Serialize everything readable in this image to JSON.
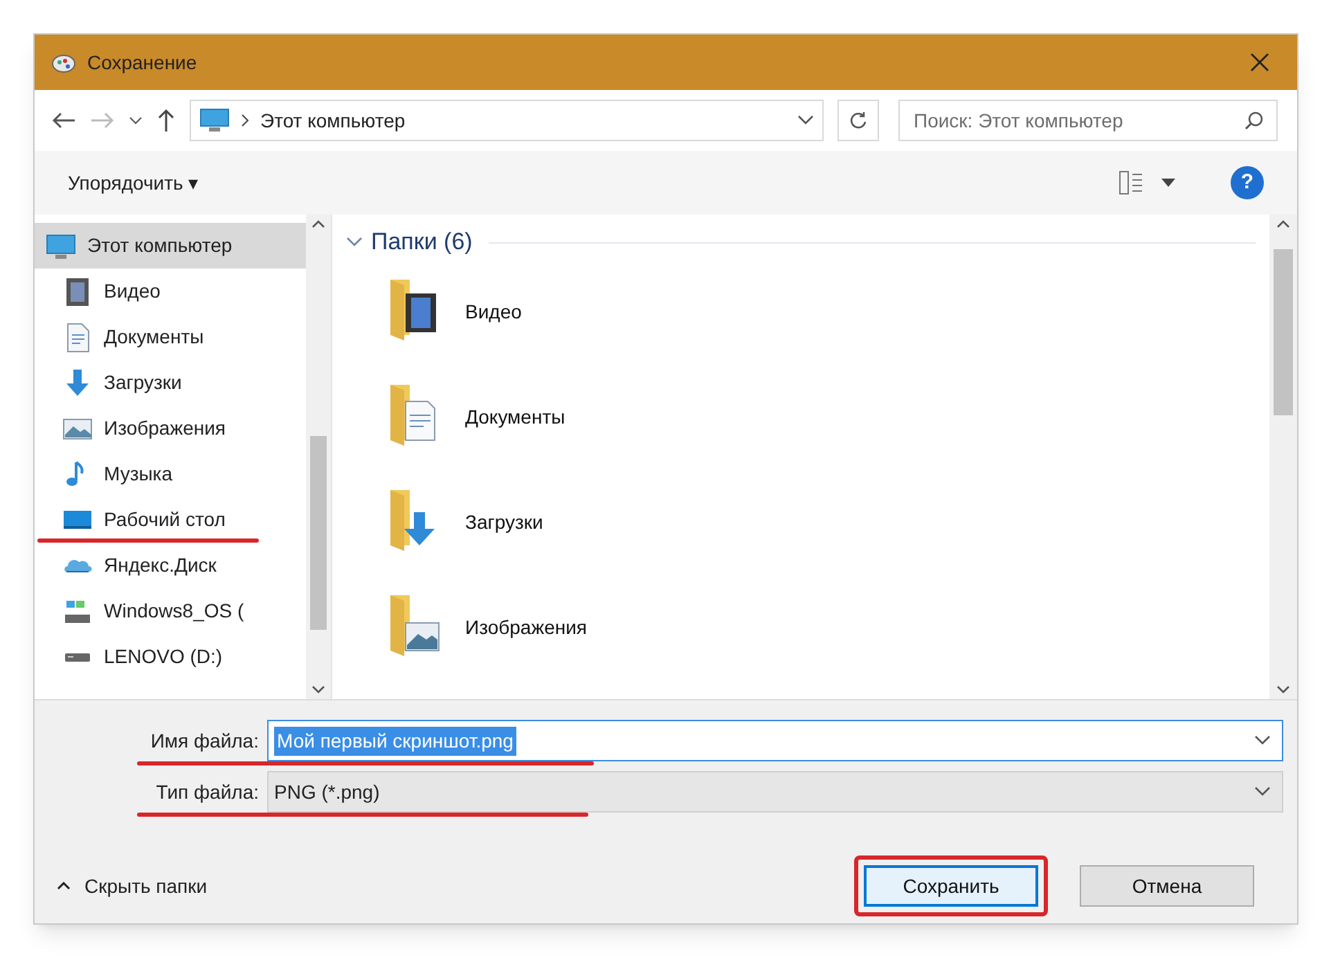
{
  "window": {
    "title": "Сохранение"
  },
  "address_bar": {
    "path": "Этот компьютер"
  },
  "search": {
    "placeholder": "Поиск: Этот компьютер"
  },
  "toolbar": {
    "organize": "Упорядочить ▾",
    "help": "?"
  },
  "sidebar": {
    "items": [
      {
        "label": "Этот компьютер",
        "kind": "pc",
        "selected": true,
        "highlighted": false,
        "children": [
          {
            "label": "Видео",
            "kind": "video",
            "selected": false,
            "highlighted": false
          },
          {
            "label": "Документы",
            "kind": "docs",
            "selected": false,
            "highlighted": false
          },
          {
            "label": "Загрузки",
            "kind": "downloads",
            "selected": false,
            "highlighted": false
          },
          {
            "label": "Изображения",
            "kind": "pictures",
            "selected": false,
            "highlighted": false
          },
          {
            "label": "Музыка",
            "kind": "music",
            "selected": false,
            "highlighted": false
          },
          {
            "label": "Рабочий стол",
            "kind": "desktop",
            "selected": false,
            "highlighted": true
          },
          {
            "label": "Яндекс.Диск",
            "kind": "cloud",
            "selected": false,
            "highlighted": false
          },
          {
            "label": "Windows8_OS (",
            "kind": "osdrive",
            "selected": false,
            "highlighted": false
          },
          {
            "label": "LENOVO (D:)",
            "kind": "drive",
            "selected": false,
            "highlighted": false
          }
        ]
      }
    ]
  },
  "content": {
    "group": "Папки (6)",
    "folders": [
      {
        "label": "Видео",
        "kind": "video"
      },
      {
        "label": "Документы",
        "kind": "docs"
      },
      {
        "label": "Загрузки",
        "kind": "downloads"
      },
      {
        "label": "Изображения",
        "kind": "pictures"
      }
    ]
  },
  "fields": [
    {
      "label": "Имя файла:",
      "value": "Мой первый скриншот.png",
      "kind": "edit",
      "highlighted": true
    },
    {
      "label": "Тип файла:",
      "value": "PNG (*.png)",
      "kind": "select",
      "highlighted": true
    }
  ],
  "hide_folders": "Скрыть папки",
  "buttons": [
    {
      "label": "Сохранить",
      "kind": "primary",
      "highlighted": true
    },
    {
      "label": "Отмена",
      "kind": "normal",
      "highlighted": false
    }
  ]
}
